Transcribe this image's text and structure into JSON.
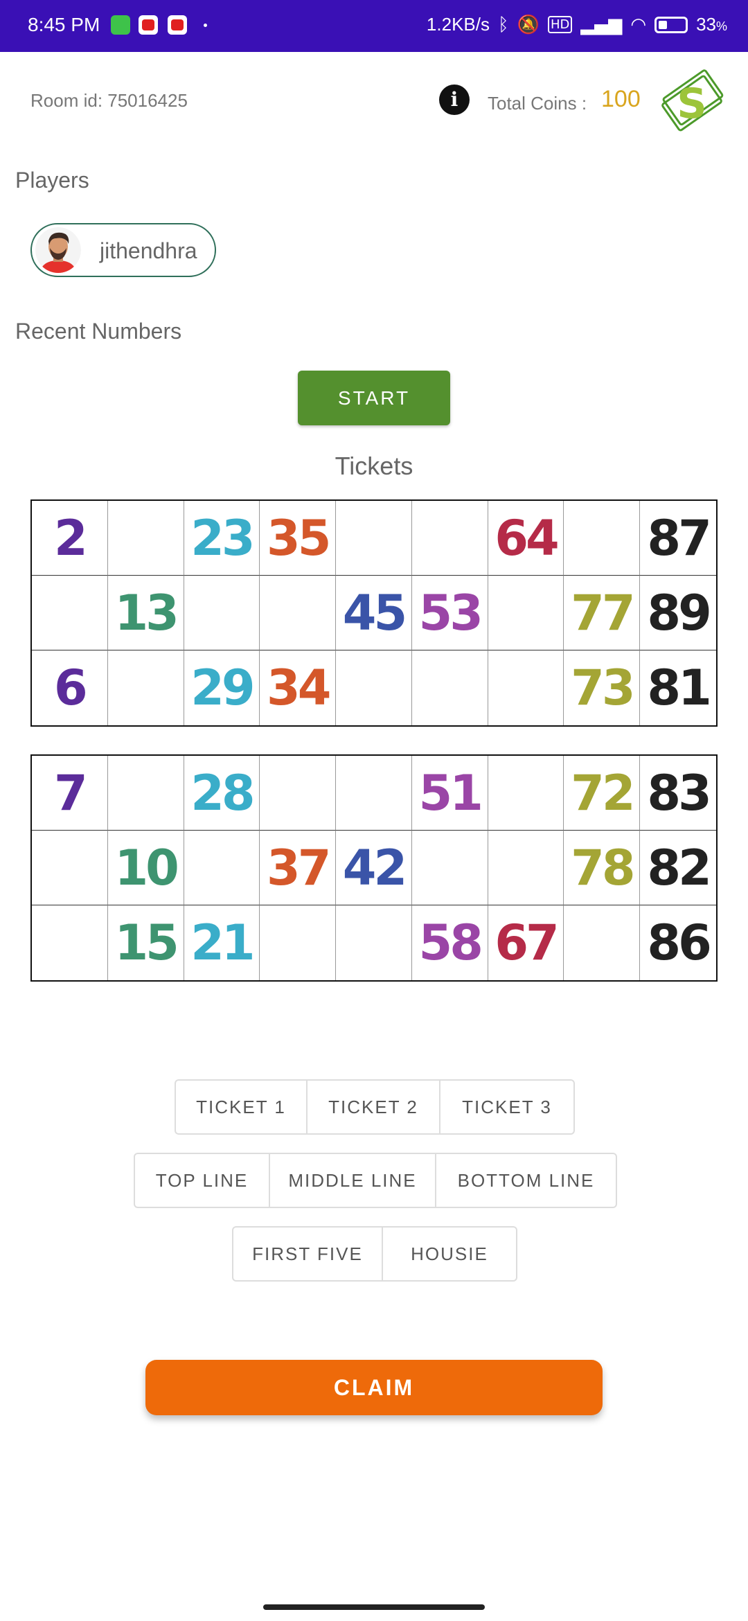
{
  "status_bar": {
    "time": "8:45 PM",
    "network_speed": "1.2KB/s",
    "battery": "33",
    "battery_unit": "%",
    "icons": [
      "bluetooth-icon",
      "mute-icon",
      "hd-icon",
      "signal-icon",
      "wifi-icon",
      "battery-icon"
    ]
  },
  "header": {
    "room_label": "Room id: 75016425",
    "coins_label": "Total Coins :",
    "coins_value": "100",
    "logo_letter": "S"
  },
  "players_section": {
    "title": "Players",
    "players": [
      {
        "name": "jithendhra"
      }
    ]
  },
  "recent_section": {
    "title": "Recent Numbers"
  },
  "start_label": "START",
  "tickets_title": "Tickets",
  "colors": {
    "purple": "#5b2c9a",
    "cyan": "#3aadc9",
    "orange": "#d4572a",
    "crimson": "#b52b48",
    "black": "#222222",
    "green": "#3e9470",
    "blue": "#3a54a8",
    "magenta": "#9a45a6",
    "olive": "#a4a535"
  },
  "tickets": [
    [
      [
        "2",
        "",
        "23",
        "35",
        "",
        "",
        "64",
        "",
        "87"
      ],
      [
        "",
        "13",
        "",
        "",
        "45",
        "53",
        "",
        "77",
        "89"
      ],
      [
        "6",
        "",
        "29",
        "34",
        "",
        "",
        "",
        "73",
        "81"
      ]
    ],
    [
      [
        "7",
        "",
        "28",
        "",
        "",
        "51",
        "",
        "72",
        "83"
      ],
      [
        "",
        "10",
        "",
        "37",
        "42",
        "",
        "",
        "78",
        "82"
      ],
      [
        "",
        "15",
        "21",
        "",
        "",
        "58",
        "67",
        "",
        "86"
      ]
    ]
  ],
  "claim_options": {
    "ticket_row": [
      "TICKET 1",
      "TICKET 2",
      "TICKET 3"
    ],
    "line_row": [
      "TOP LINE",
      "MIDDLE LINE",
      "BOTTOM LINE"
    ],
    "special_row": [
      "FIRST FIVE",
      "HOUSIE"
    ]
  },
  "claim_label": "CLAIM"
}
